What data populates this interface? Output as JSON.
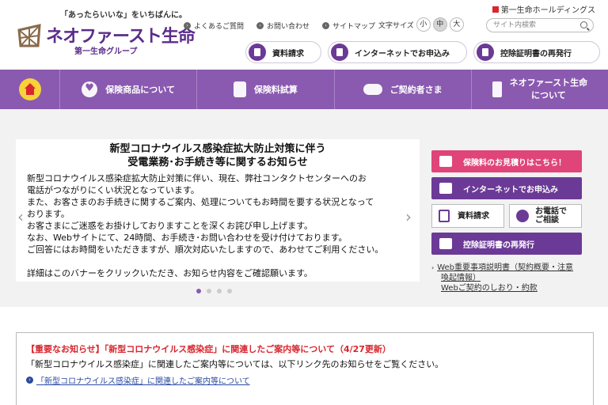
{
  "header": {
    "tagline": "「あったらいいな」をいちばんに。",
    "brand_name": "ネオファースト生命",
    "brand_sub": "第一生命グループ",
    "holdings_link": "第一生命ホールディングス",
    "utility_links": [
      "よくあるご質問",
      "お問い合わせ",
      "サイトマップ"
    ],
    "font_size_label": "文字サイズ",
    "font_sizes": [
      "小",
      "中",
      "大"
    ],
    "font_size_selected": "中",
    "search_placeholder": "サイト内検索",
    "action_buttons": [
      "資料請求",
      "インターネットでお申込み",
      "控除証明書の再発行"
    ]
  },
  "nav": {
    "items": [
      {
        "label": "保険商品について",
        "icon": "heart-icon"
      },
      {
        "label": "保険料試算",
        "icon": "calculator-icon"
      },
      {
        "label": "ご契約者さま",
        "icon": "handshake-icon"
      },
      {
        "label_line1": "ネオファースト生命",
        "label_line2": "について",
        "icon": "building-icon"
      }
    ]
  },
  "banner": {
    "title_line1": "新型コロナウイルス感染症拡大防止対策に伴う",
    "title_line2": "受電業務･お手続き等に関するお知らせ",
    "p1_l1": "新型コロナウイルス感染症拡大防止対策に伴い、現在、弊社コンタクトセンターへのお",
    "p1_l2": "電話がつながりにくい状況となっています。",
    "p1_l3": "また、お客さまのお手続きに関するご案内、処理についてもお時間を要する状況となって",
    "p1_l4": "おります。",
    "p1_l5": "お客さまにご迷惑をお掛けしておりますことを深くお詫び申し上げます。",
    "p1_l6": "なお、Webサイトにて、24時間、お手続き･お問い合わせを受け付けております。",
    "p1_l7": "ご回答にはお時間をいただきますが、順次対応いたしますので、あわせてご利用ください。",
    "p2": "詳細はこのバナーをクリックいただき、お知らせ内容をご確認願います。",
    "dots_total": 4,
    "dots_active": 1
  },
  "sidebar": {
    "estimate_button": "保険料のお見積りはこちら！",
    "internet_button": "インターネットでお申込み",
    "brochure_button": "資料請求",
    "phone_button_l1": "お電話で",
    "phone_button_l2": "ご相談",
    "certificate_button": "控除証明書の再発行",
    "link1_l1": "Web重要事項説明書（契約概要・注意",
    "link1_l2": "喚起情報）",
    "link2": "Webご契約のしおり・約款"
  },
  "notice": {
    "title": "【重要なお知らせ】「新型コロナウイルス感染症」に関連したご案内等について（4/27更新）",
    "body": "「新型コロナウイルス感染症」に関連したご案内等については、以下リンク先のお知らせをご覧ください。",
    "link": "「新型コロナウイルス感染症」に関連したご案内等について"
  },
  "colors": {
    "brand_purple": "#6b3a96",
    "nav_purple": "#8a5ab0",
    "accent_pink": "#e0457a",
    "alert_red": "#d8262e"
  }
}
